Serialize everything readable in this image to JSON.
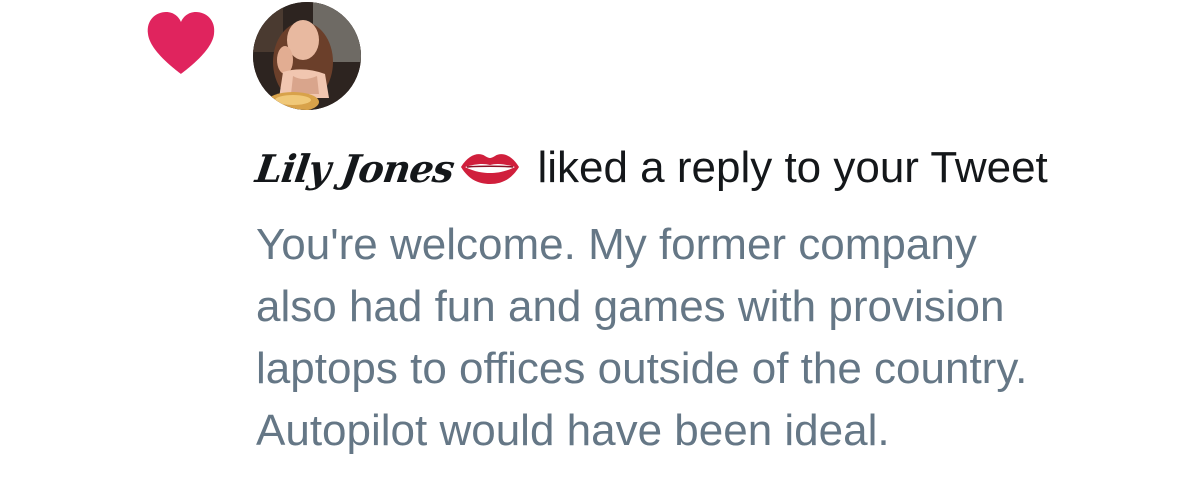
{
  "notification": {
    "type_icon": "heart-icon",
    "type_icon_color": "#e0245e",
    "avatar_icon": "profile-photo",
    "user_name": "Lily Jones",
    "user_name_decoration": "lips-emoji",
    "action": "liked a reply to your Tweet",
    "tweet_lines": [
      "You're welcome. My former company",
      "also had fun and games with provision",
      "laptops to offices outside of the country.",
      "Autopilot would have been ideal."
    ]
  },
  "colors": {
    "heart": "#e0245e",
    "primary_text": "#14171a",
    "secondary_text": "#657786",
    "background": "#ffffff"
  }
}
